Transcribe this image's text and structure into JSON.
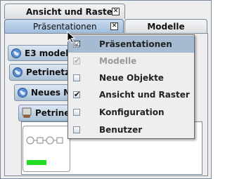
{
  "tabs": {
    "ansicht": {
      "label": "Ansicht und Raster",
      "close": "✕"
    },
    "praesentationen": {
      "label": "Präsentationen",
      "close": "✕"
    },
    "modelle": {
      "label": "Modelle"
    }
  },
  "tree_rows": {
    "e3": {
      "label": "E3 model"
    },
    "petrinetz": {
      "label": "Petrinetz"
    },
    "neues": {
      "label": "Neues M"
    },
    "petrine": {
      "label": "Petrine"
    }
  },
  "menu": {
    "items": [
      {
        "label": "Präsentationen",
        "mark": "☑",
        "selected": true,
        "enabled": true
      },
      {
        "label": "Modelle",
        "mark": "✔",
        "selected": false,
        "enabled": false
      },
      {
        "label": "Neue Objekte",
        "mark": "",
        "selected": false,
        "enabled": true
      },
      {
        "label": "Ansicht und Raster",
        "mark": "✔",
        "selected": false,
        "enabled": true
      },
      {
        "label": "Konfiguration",
        "mark": "",
        "selected": false,
        "enabled": true
      },
      {
        "label": "Benutzer",
        "mark": "",
        "selected": false,
        "enabled": true
      }
    ]
  },
  "colors": {
    "active_tab": "#b3cbe4",
    "row_gradient_top": "#dde7f2",
    "row_gradient_bottom": "#aabfd6",
    "menu_highlight": "#a6bbd1",
    "thumb_green": "#22dd22"
  }
}
